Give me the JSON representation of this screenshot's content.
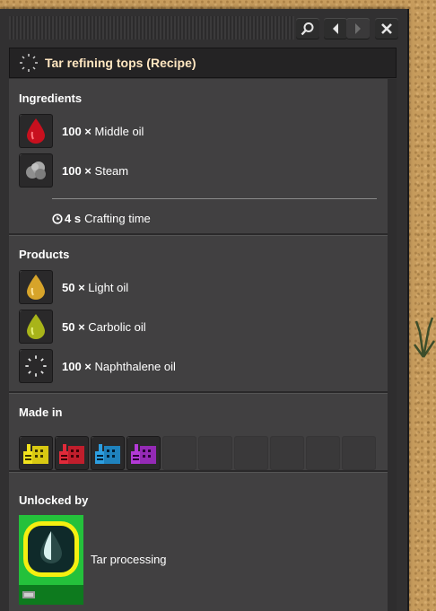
{
  "window": {
    "title": "Tar refining tops (Recipe)",
    "buttons": {
      "search_icon": "search-icon",
      "back_icon": "back-arrow-icon",
      "forward_icon": "forward-arrow-icon",
      "close_icon": "close-icon"
    }
  },
  "ingredients": {
    "heading": "Ingredients",
    "items": [
      {
        "amount": "100 ×",
        "name": "Middle oil",
        "color": "#c8101e"
      },
      {
        "amount": "100 ×",
        "name": "Steam",
        "color": "#9a9a9a"
      }
    ],
    "crafting_time_value": "4 s",
    "crafting_time_label": "Crafting time"
  },
  "products": {
    "heading": "Products",
    "items": [
      {
        "amount": "50 ×",
        "name": "Light oil",
        "color": "#d7a42a"
      },
      {
        "amount": "50 ×",
        "name": "Carbolic oil",
        "color": "#a8b419"
      },
      {
        "amount": "100 ×",
        "name": "Naphthalene oil",
        "color": "#e8e8e8"
      }
    ]
  },
  "made_in": {
    "heading": "Made in",
    "machine_colors": [
      "#f2e31e",
      "#e02a3a",
      "#2d9ee0",
      "#b33ad6"
    ]
  },
  "unlocked_by": {
    "heading": "Unlocked by",
    "technology": "Tar processing"
  }
}
